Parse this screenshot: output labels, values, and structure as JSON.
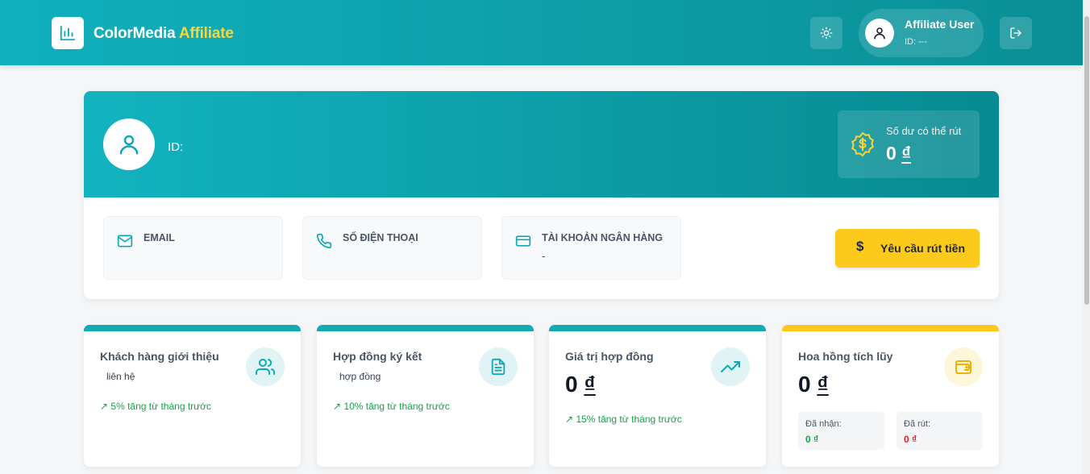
{
  "header": {
    "brand_name": "ColorMedia",
    "brand_accent": "Affiliate",
    "user_name": "Affiliate User",
    "user_id": "ID: ---"
  },
  "profile": {
    "id_label": "ID:",
    "balance_label": "Số dư có thể rút",
    "balance_value": "0 ",
    "currency": "₫",
    "email_label": "EMAIL",
    "email_value": "",
    "phone_label": "SỐ ĐIỆN THOẠI",
    "phone_value": "",
    "bank_label": "TÀI KHOẢN NGÂN HÀNG",
    "bank_value": "-",
    "withdraw_icon": "$",
    "withdraw_label": "Yêu cầu rút tiền"
  },
  "stats": [
    {
      "title": "Khách hàng giới thiệu",
      "sub": "liên hệ",
      "trend": "5% tăng từ tháng trước",
      "icon": "users-icon"
    },
    {
      "title": "Hợp đồng ký kết",
      "sub": "hợp đồng",
      "trend": "10% tăng từ tháng trước",
      "icon": "document-icon"
    },
    {
      "title": "Giá trị hợp đồng",
      "value": "0 ",
      "trend": "15% tăng từ tháng trước",
      "icon": "trending-up-icon"
    },
    {
      "title": "Hoa hồng tích lũy",
      "value": "0 ",
      "received_label": "Đã nhận:",
      "received_value": "0 ₫",
      "withdrawn_label": "Đã rút:",
      "withdrawn_value": "0 ₫",
      "icon": "wallet-icon"
    }
  ],
  "colors": {
    "primary": "#10b0bd",
    "accent": "#fdca1c",
    "success": "#16a34a",
    "danger": "#dc2626"
  }
}
